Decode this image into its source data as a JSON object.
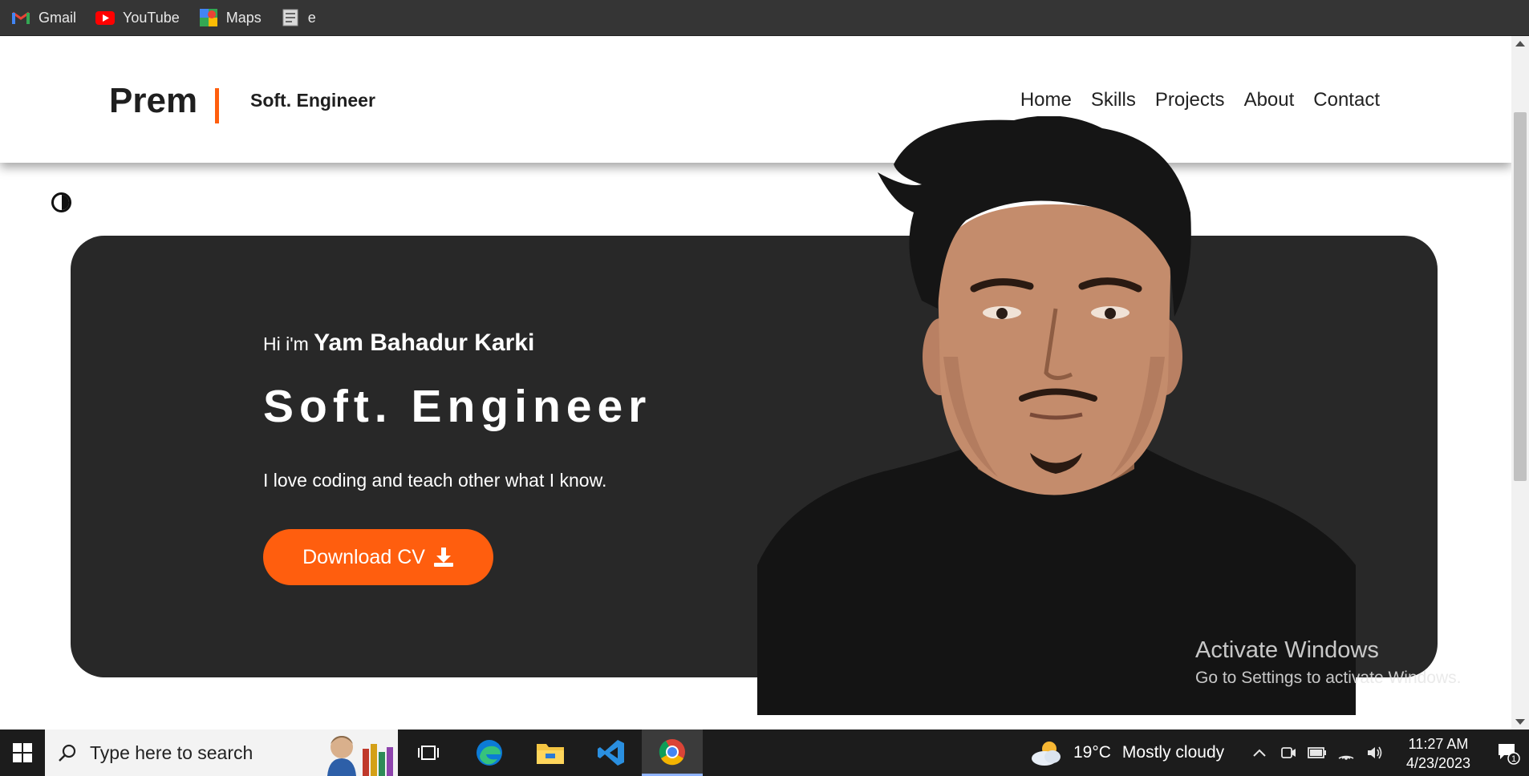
{
  "bookmarks": [
    {
      "label": "Gmail",
      "icon": "gmail-icon"
    },
    {
      "label": "YouTube",
      "icon": "youtube-icon"
    },
    {
      "label": "Maps",
      "icon": "maps-icon"
    },
    {
      "label": "e",
      "icon": "document-icon"
    }
  ],
  "header": {
    "brand": "Prem",
    "subtitle": "Soft. Engineer",
    "nav": [
      "Home",
      "Skills",
      "Projects",
      "About",
      "Contact"
    ]
  },
  "hero": {
    "greeting_prefix": "Hi i'm",
    "name": "Yam Bahadur Karki",
    "role": "Soft. Engineer",
    "tagline": "I love coding and teach other what I know.",
    "cv_button": "Download CV"
  },
  "watermark": {
    "line1": "Activate Windows",
    "line2": "Go to Settings to activate Windows."
  },
  "taskbar": {
    "search_placeholder": "Type here to search",
    "weather_temp": "19°C",
    "weather_desc": "Mostly cloudy",
    "time": "11:27 AM",
    "date": "4/23/2023",
    "notification_count": "1"
  },
  "colors": {
    "accent": "#ff5e0e",
    "hero_bg": "#282828",
    "bookmarks_bg": "#353535",
    "taskbar_bg": "#1c1c1c"
  }
}
